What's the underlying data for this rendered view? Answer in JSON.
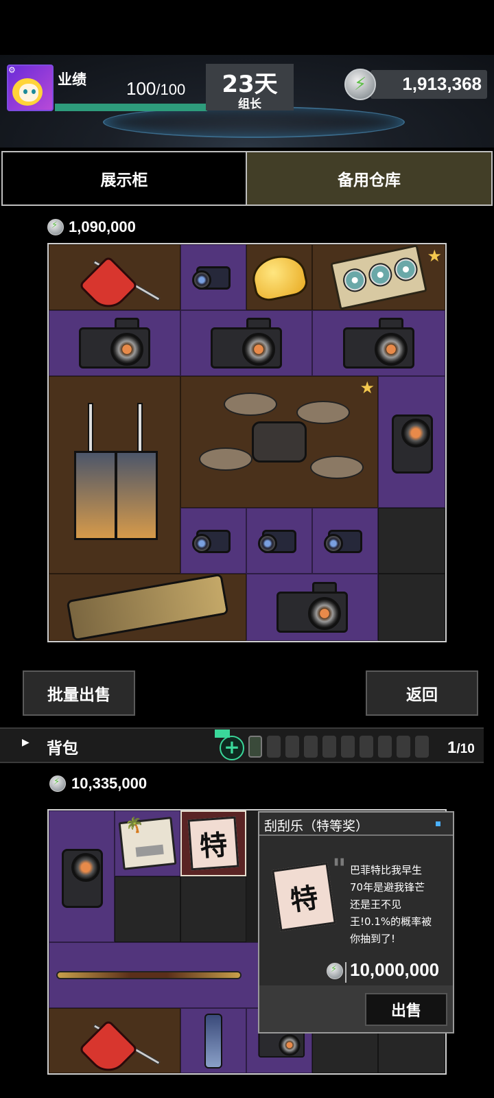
{
  "header": {
    "performance_label": "业绩",
    "performance_current": "100",
    "performance_sep": "/",
    "performance_max": "100",
    "performance_fraction": 1.0,
    "days": "23天",
    "rank": "组长",
    "money": "1,913,368"
  },
  "tabs": [
    {
      "label": "展示柜",
      "selected": false
    },
    {
      "label": "备用仓库",
      "selected": true
    }
  ],
  "warehouse": {
    "value": "1,090,000",
    "items": [
      {
        "name": "ruby-mop",
        "bg": "brown"
      },
      {
        "name": "scope",
        "bg": "purple"
      },
      {
        "name": "cheese",
        "bg": "brown"
      },
      {
        "name": "cassette",
        "bg": "brown",
        "starred": true
      },
      {
        "name": "camera",
        "bg": "purple"
      },
      {
        "name": "camera",
        "bg": "purple"
      },
      {
        "name": "camera",
        "bg": "purple"
      },
      {
        "name": "overalls",
        "bg": "brown"
      },
      {
        "name": "drone",
        "bg": "brown",
        "starred": true
      },
      {
        "name": "camcorder",
        "bg": "purple"
      },
      {
        "name": "scope",
        "bg": "purple"
      },
      {
        "name": "scope",
        "bg": "purple"
      },
      {
        "name": "scope",
        "bg": "purple"
      },
      {
        "name": "gold-phone",
        "bg": "brown"
      },
      {
        "name": "camera",
        "bg": "purple"
      }
    ]
  },
  "buttons": {
    "bulk_sell": "批量出售",
    "back": "返回"
  },
  "bag": {
    "label": "背包",
    "expand_icon": "triangle-right-icon",
    "add_icon": "plus-icon",
    "slot_count_current": "1",
    "slot_count_max": "/10",
    "value": "10,335,000"
  },
  "tooltip": {
    "title": "刮刮乐（特等奖）",
    "icon_char": "特",
    "desc": [
      "巴菲特比我早生",
      "70年是避我锋芒",
      "还是王不见",
      "王!0.1%的概率被",
      "你抽到了!"
    ],
    "price": "10,000,000",
    "sell": "出售"
  },
  "colors": {
    "accent_green": "#2e9c7c",
    "cell_brown": "#4a311b",
    "cell_purple": "#52357c",
    "star": "#f4c84e"
  }
}
